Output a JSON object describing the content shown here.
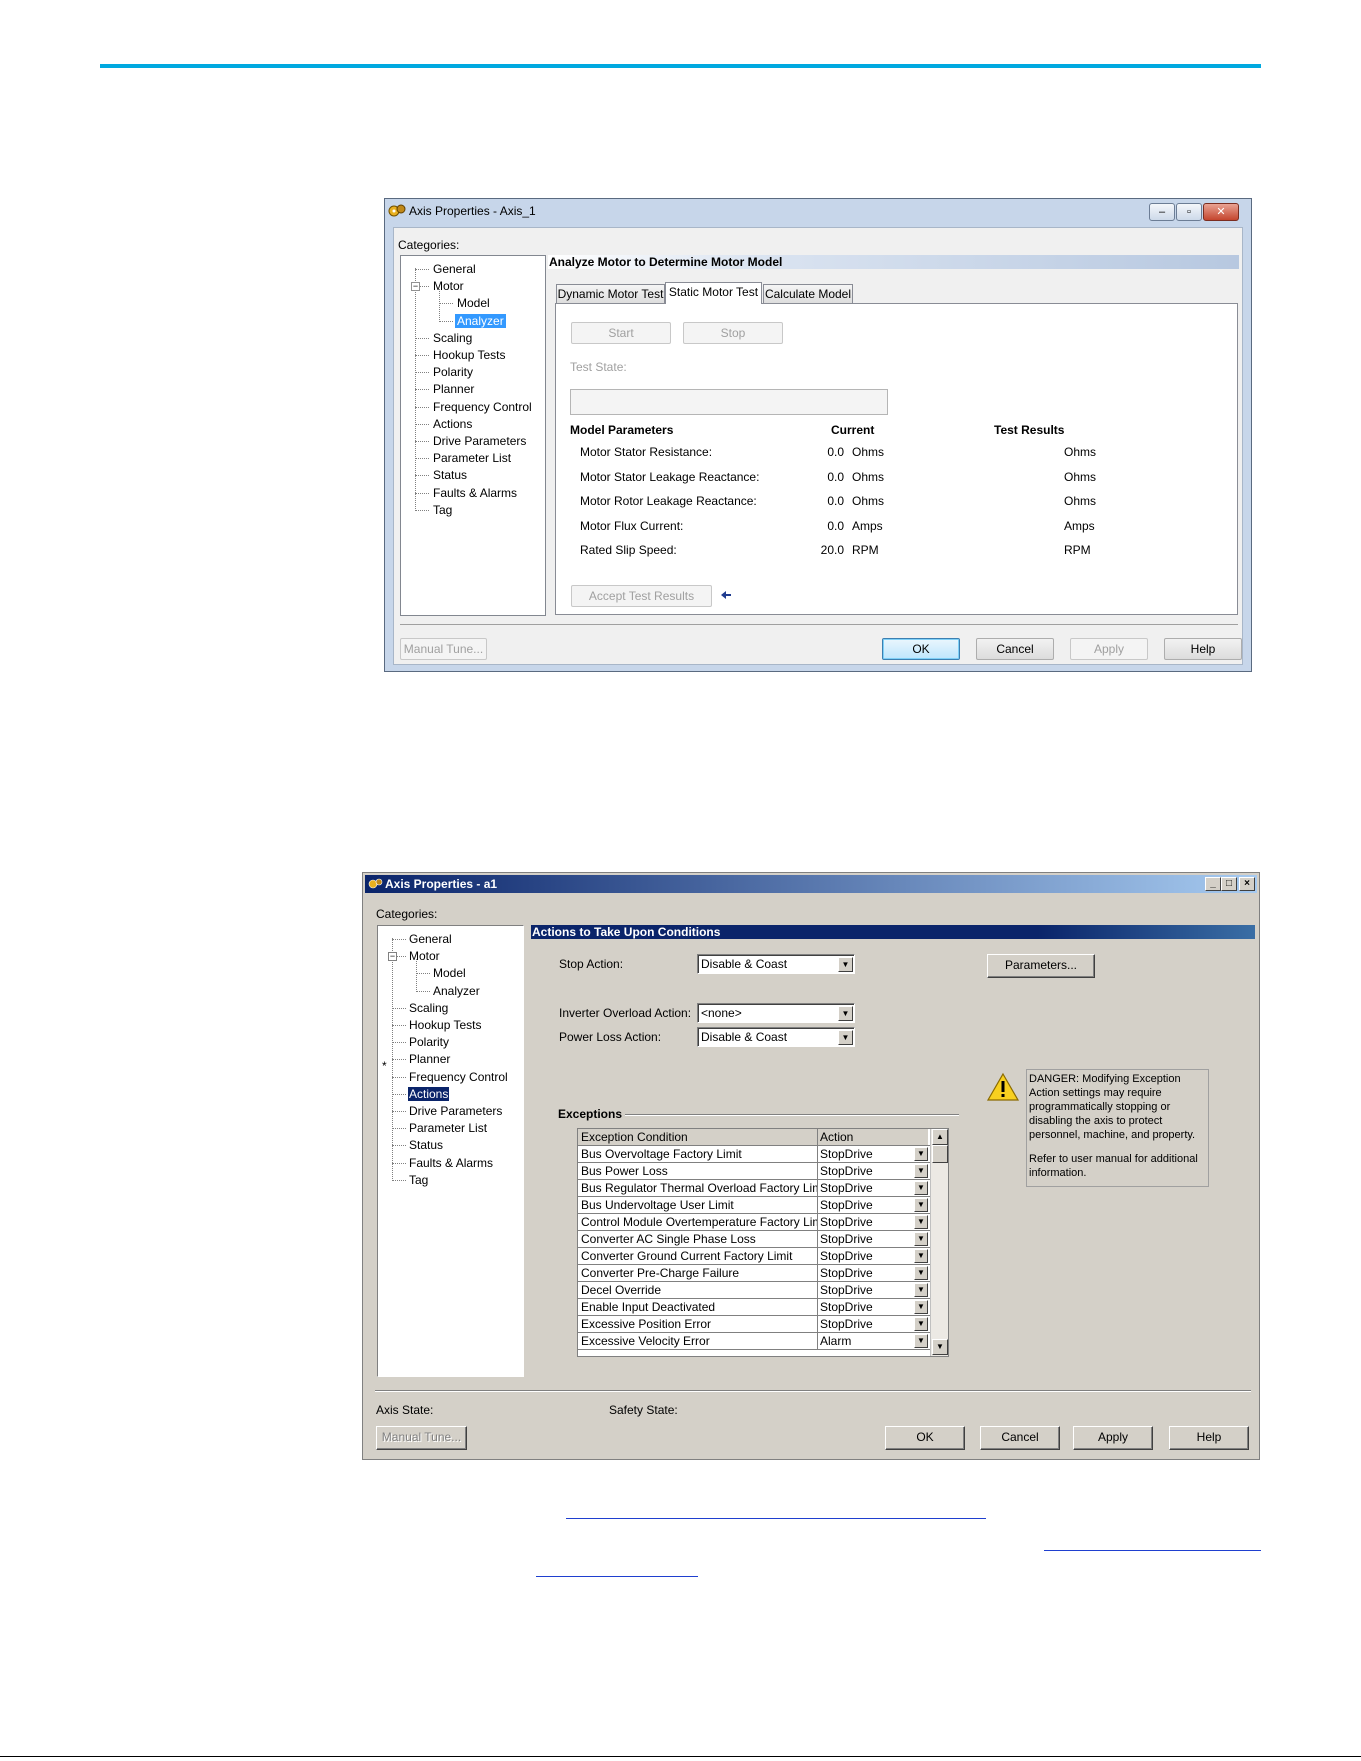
{
  "dialog1": {
    "title": "Axis Properties - Axis_1",
    "categories_label": "Categories:",
    "tree": [
      {
        "label": "General",
        "selected": false
      },
      {
        "label": "Motor",
        "selected": false
      },
      {
        "label": "Model",
        "selected": false
      },
      {
        "label": "Analyzer",
        "selected": true
      },
      {
        "label": "Scaling",
        "selected": false
      },
      {
        "label": "Hookup Tests",
        "selected": false
      },
      {
        "label": "Polarity",
        "selected": false
      },
      {
        "label": "Planner",
        "selected": false
      },
      {
        "label": "Frequency Control",
        "selected": false
      },
      {
        "label": "Actions",
        "selected": false
      },
      {
        "label": "Drive Parameters",
        "selected": false
      },
      {
        "label": "Parameter List",
        "selected": false
      },
      {
        "label": "Status",
        "selected": false
      },
      {
        "label": "Faults & Alarms",
        "selected": false
      },
      {
        "label": "Tag",
        "selected": false
      }
    ],
    "section_header": "Analyze Motor to Determine Motor Model",
    "tabs": [
      {
        "label": "Dynamic Motor Test",
        "active": false
      },
      {
        "label": "Static Motor Test",
        "active": true
      },
      {
        "label": "Calculate Model",
        "active": false
      }
    ],
    "start_label": "Start",
    "stop_label": "Stop",
    "test_state_label": "Test State:",
    "test_state_value": "",
    "col_params": "Model Parameters",
    "col_current": "Current",
    "col_results": "Test Results",
    "params": [
      {
        "name": "Motor Stator Resistance:",
        "value": "0.0",
        "unit": "Ohms",
        "result_unit": "Ohms"
      },
      {
        "name": "Motor Stator Leakage Reactance:",
        "value": "0.0",
        "unit": "Ohms",
        "result_unit": "Ohms"
      },
      {
        "name": "Motor Rotor Leakage Reactance:",
        "value": "0.0",
        "unit": "Ohms",
        "result_unit": "Ohms"
      },
      {
        "name": "Motor Flux Current:",
        "value": "0.0",
        "unit": "Amps",
        "result_unit": "Amps"
      },
      {
        "name": "Rated Slip Speed:",
        "value": "20.0",
        "unit": "RPM",
        "result_unit": "RPM"
      }
    ],
    "accept_label": "Accept Test Results",
    "manual_tune_label": "Manual Tune...",
    "ok_label": "OK",
    "cancel_label": "Cancel",
    "apply_label": "Apply",
    "help_label": "Help"
  },
  "dialog2": {
    "title": "Axis Properties - a1",
    "categories_label": "Categories:",
    "tree": [
      {
        "label": "General",
        "selected": false
      },
      {
        "label": "Motor",
        "selected": false
      },
      {
        "label": "Model",
        "selected": false
      },
      {
        "label": "Analyzer",
        "selected": false
      },
      {
        "label": "Scaling",
        "selected": false
      },
      {
        "label": "Hookup Tests",
        "selected": false
      },
      {
        "label": "Polarity",
        "selected": false
      },
      {
        "label": "Planner",
        "selected": false
      },
      {
        "label": "Frequency Control",
        "selected": false
      },
      {
        "label": "Actions",
        "selected": true
      },
      {
        "label": "Drive Parameters",
        "selected": false
      },
      {
        "label": "Parameter List",
        "selected": false
      },
      {
        "label": "Status",
        "selected": false
      },
      {
        "label": "Faults & Alarms",
        "selected": false
      },
      {
        "label": "Tag",
        "selected": false
      }
    ],
    "modified_marker": "*",
    "section_header": "Actions to Take Upon Conditions",
    "stop_action_label": "Stop Action:",
    "stop_action_value": "Disable & Coast",
    "parameters_label": "Parameters...",
    "inverter_label": "Inverter Overload Action:",
    "inverter_value": "<none>",
    "power_loss_label": "Power Loss Action:",
    "power_loss_value": "Disable & Coast",
    "danger_text": "DANGER: Modifying Exception Action settings may require programmatically stopping or disabling the axis to protect personnel, machine, and property.",
    "refer_text": "Refer to user manual for additional information.",
    "exceptions_label": "Exceptions",
    "col_condition": "Exception Condition",
    "col_action": "Action",
    "exceptions": [
      {
        "condition": "Bus Overvoltage Factory Limit",
        "action": "StopDrive"
      },
      {
        "condition": "Bus Power Loss",
        "action": "StopDrive"
      },
      {
        "condition": "Bus Regulator Thermal Overload Factory Limit",
        "action": "StopDrive"
      },
      {
        "condition": "Bus Undervoltage User Limit",
        "action": "StopDrive"
      },
      {
        "condition": "Control Module Overtemperature Factory Limit",
        "action": "StopDrive"
      },
      {
        "condition": "Converter AC Single Phase Loss",
        "action": "StopDrive"
      },
      {
        "condition": "Converter Ground Current Factory Limit",
        "action": "StopDrive"
      },
      {
        "condition": "Converter Pre-Charge Failure",
        "action": "StopDrive"
      },
      {
        "condition": "Decel Override",
        "action": "StopDrive"
      },
      {
        "condition": "Enable Input Deactivated",
        "action": "StopDrive"
      },
      {
        "condition": "Excessive Position Error",
        "action": "StopDrive"
      },
      {
        "condition": "Excessive Velocity Error",
        "action": "Alarm"
      }
    ],
    "axis_state_label": "Axis State:",
    "safety_state_label": "Safety State:",
    "manual_tune_label": "Manual Tune...",
    "ok_label": "OK",
    "cancel_label": "Cancel",
    "apply_label": "Apply",
    "help_label": "Help"
  },
  "colors": {
    "accent_line": "#00a9e0",
    "win7_selection": "#3399ff",
    "classic_title": "#0a246a"
  }
}
